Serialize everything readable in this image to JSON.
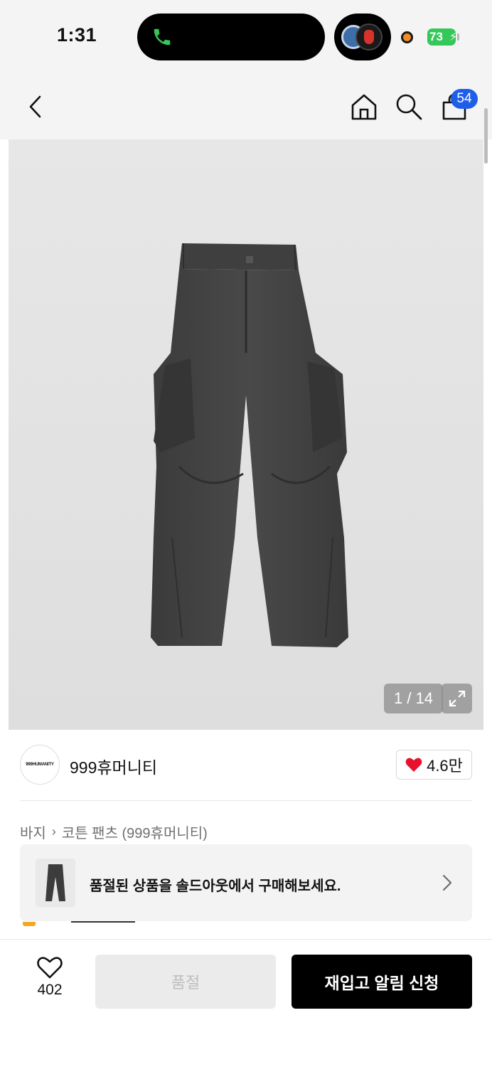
{
  "status_bar": {
    "time": "1:31",
    "battery": "73",
    "icons": [
      "phone-call-icon",
      "live-activity-icon",
      "recording-dot-icon",
      "battery-charging-icon"
    ]
  },
  "nav": {
    "icons": [
      "back-chevron-icon",
      "home-icon",
      "search-icon",
      "shopping-bag-icon"
    ],
    "cart_count": "54"
  },
  "product": {
    "image_counter": "1 / 14",
    "image_icons": [
      "expand-icon"
    ]
  },
  "brand": {
    "logo_text": "999HUMANITY",
    "name": "999휴머니티",
    "like_count": "4.6만"
  },
  "breadcrumb": {
    "category": "바지",
    "subcategory": "코튼 팬츠 (999휴머니티)"
  },
  "soldout_banner": {
    "text": "품절된 상품을 솔드아웃에서 구매해보세요."
  },
  "bottom_bar": {
    "wish_count": "402",
    "soldout_label": "품절",
    "restock_label": "재입고 알림 신청"
  },
  "colors": {
    "accent": "#1f5ee8",
    "heart": "#e8112d",
    "primary_button": "#000000",
    "disabled_button": "#ebebeb",
    "battery": "#34c759"
  }
}
